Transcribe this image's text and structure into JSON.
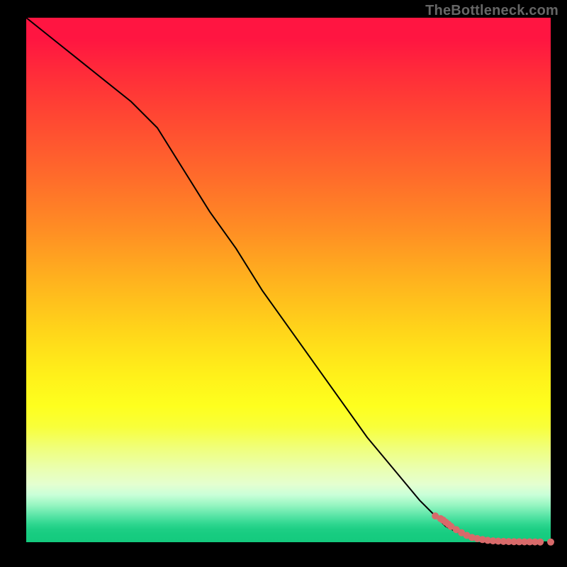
{
  "watermark": "TheBottleneck.com",
  "chart_data": {
    "type": "line",
    "title": "",
    "xlabel": "",
    "ylabel": "",
    "xlim": [
      0,
      100
    ],
    "ylim": [
      0,
      100
    ],
    "grid": false,
    "legend": false,
    "background_heat_axis": "y",
    "background_heat_colors": [
      {
        "stop": 0,
        "color": "#14ca7e"
      },
      {
        "stop": 5,
        "color": "#2fd790"
      },
      {
        "stop": 10,
        "color": "#eaffb0"
      },
      {
        "stop": 25,
        "color": "#feff1e"
      },
      {
        "stop": 50,
        "color": "#ffb21e"
      },
      {
        "stop": 75,
        "color": "#ff6a2b"
      },
      {
        "stop": 100,
        "color": "#ff1541"
      }
    ],
    "series": [
      {
        "name": "curve",
        "style": "line",
        "color": "#000000",
        "x": [
          0,
          5,
          10,
          15,
          20,
          25,
          30,
          35,
          40,
          45,
          50,
          55,
          60,
          65,
          70,
          75,
          78,
          80,
          82,
          84,
          86,
          88,
          90,
          92,
          94,
          96,
          98,
          100
        ],
        "y": [
          100,
          96,
          92,
          88,
          84,
          79,
          71,
          63,
          56,
          48,
          41,
          34,
          27,
          20,
          14,
          8,
          5,
          3,
          2,
          1.3,
          0.9,
          0.6,
          0.4,
          0.25,
          0.15,
          0.08,
          0.03,
          0
        ]
      },
      {
        "name": "points",
        "style": "marker",
        "marker": "circle",
        "color": "#d86a6a",
        "radius": 5,
        "x": [
          78,
          79,
          79.5,
          80,
          80.5,
          81,
          82,
          83,
          84,
          85,
          86,
          87,
          88,
          89,
          90,
          91,
          92,
          93,
          94,
          95,
          96,
          97,
          98,
          100
        ],
        "y": [
          5,
          4.5,
          4.2,
          3.8,
          3.4,
          3.0,
          2.4,
          1.8,
          1.3,
          0.9,
          0.7,
          0.5,
          0.35,
          0.25,
          0.2,
          0.15,
          0.12,
          0.1,
          0.08,
          0.07,
          0.06,
          0.05,
          0.04,
          0.03
        ]
      }
    ]
  }
}
